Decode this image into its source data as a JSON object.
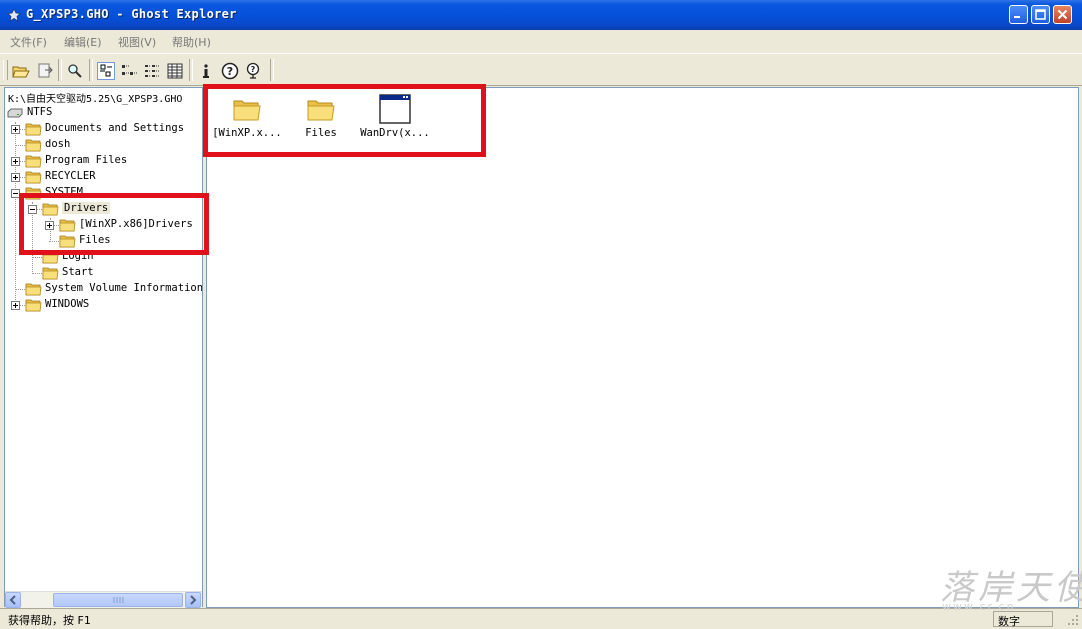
{
  "window": {
    "title": "G_XPSP3.GHO - Ghost Explorer"
  },
  "menu": [
    {
      "label": "文件(F)"
    },
    {
      "label": "编辑(E)"
    },
    {
      "label": "视图(V)"
    },
    {
      "label": "帮助(H)"
    }
  ],
  "toolbar": {
    "buttons": [
      {
        "icon": "open-folder-icon"
      },
      {
        "icon": "extract-icon"
      },
      {
        "icon": "search-icon"
      },
      {
        "icon": "large-icons-view-icon",
        "pressed": true
      },
      {
        "icon": "small-icons-view-icon"
      },
      {
        "icon": "list-view-icon"
      },
      {
        "icon": "details-view-icon"
      },
      {
        "icon": "info-icon"
      },
      {
        "icon": "help-icon"
      },
      {
        "icon": "whats-this-icon"
      }
    ]
  },
  "tree": {
    "path": "K:\\自由天空驱动5.25\\G_XPSP3.GHO",
    "drive": "NTFS",
    "nodes": [
      {
        "label": "Documents and Settings"
      },
      {
        "label": "dosh"
      },
      {
        "label": "Program Files"
      },
      {
        "label": "RECYCLER"
      },
      {
        "label": "SYSTEM"
      },
      {
        "label": "Drivers"
      },
      {
        "label": "[WinXP.x86]Drivers"
      },
      {
        "label": "Files"
      },
      {
        "label": "Login"
      },
      {
        "label": "Start"
      },
      {
        "label": "System Volume Information"
      },
      {
        "label": "WINDOWS"
      }
    ]
  },
  "content": {
    "items": [
      {
        "name": "[WinXP.x...",
        "type": "folder"
      },
      {
        "name": "Files",
        "type": "folder"
      },
      {
        "name": "WanDrv(x...",
        "type": "application"
      }
    ]
  },
  "status": {
    "text": "获得帮助，按 F1",
    "panel": "数字"
  },
  "watermark": {
    "text": "落岸天使",
    "sub": "www.cr.cn"
  },
  "colors": {
    "annotation": "#e0111b",
    "title_bar": "#0a58e0"
  }
}
